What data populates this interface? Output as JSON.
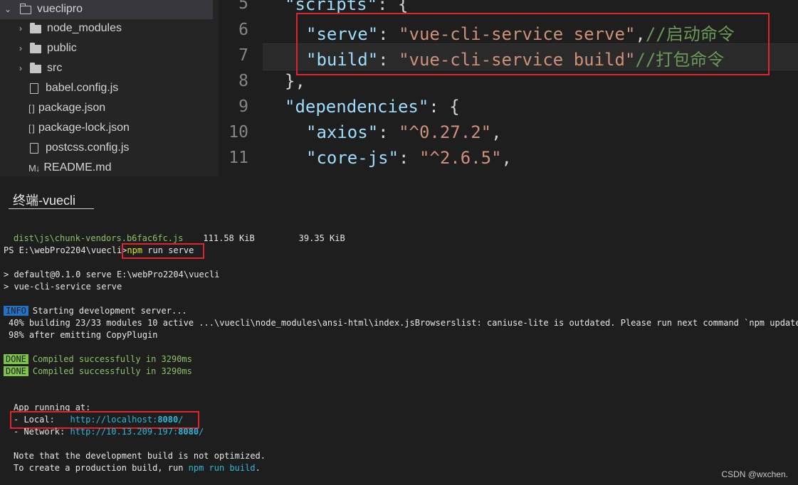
{
  "explorer": {
    "root": {
      "label": "vueclipro"
    },
    "items": [
      {
        "label": "node_modules"
      },
      {
        "label": "public"
      },
      {
        "label": "src"
      },
      {
        "label": "babel.config.js",
        "icon_glyph": ""
      },
      {
        "label": "package.json",
        "icon_glyph": "[ ]"
      },
      {
        "label": "package-lock.json",
        "icon_glyph": "[ ]"
      },
      {
        "label": "postcss.config.js",
        "icon_glyph": ""
      },
      {
        "label": "README.md",
        "icon_glyph": "M↓"
      }
    ]
  },
  "editor": {
    "lines": [
      {
        "num": "5",
        "t1": "\"scripts\"",
        "t2": ": {",
        "t3": "",
        "t4": "",
        "t5": ""
      },
      {
        "num": "6",
        "t1": "\"serve\"",
        "t2": ": ",
        "t3": "\"vue-cli-service serve\"",
        "t4": ",",
        "t5": "//启动命令"
      },
      {
        "num": "7",
        "t1": "\"build\"",
        "t2": ": ",
        "t3": "\"vue-cli-service build\"",
        "t4": "",
        "t5": "//打包命令"
      },
      {
        "num": "8",
        "t1": "",
        "t2": "},",
        "t3": "",
        "t4": "",
        "t5": ""
      },
      {
        "num": "9",
        "t1": "\"dependencies\"",
        "t2": ": {",
        "t3": "",
        "t4": "",
        "t5": ""
      },
      {
        "num": "10",
        "t1": "\"axios\"",
        "t2": ": ",
        "t3": "\"^0.27.2\"",
        "t4": ",",
        "t5": ""
      },
      {
        "num": "11",
        "t1": "\"core-js\"",
        "t2": ": ",
        "t3": "\"^2.6.5\"",
        "t4": ",",
        "t5": ""
      }
    ]
  },
  "terminal": {
    "tab_label": "终端-vuecli",
    "line_chunk_name": "dist\\js\\chunk-vendors.b6fac6fc.js",
    "line_chunk_size": "111.58 KiB",
    "line_chunk_gzip": "39.35 KiB",
    "prompt": "PS E:\\webPro2204\\vuecli>",
    "command_npm": "npm",
    "command_rest": " run serve",
    "line_default": "> default@0.1.0 serve E:\\webPro2204\\vuecli",
    "line_service": "> vue-cli-service serve",
    "info_badge": "INFO",
    "info_text": "Starting development server...",
    "line_building": "40% building 23/33 modules 10 active ...\\vuecli\\node_modules\\ansi-html\\index.jsBrowserslist: caniuse-lite is outdated. Please run next command `npm update`",
    "line_emitting": "98% after emitting CopyPlugin",
    "done_badge": "DONE",
    "done_text": "Compiled successfully in 3290ms",
    "app_running": "App running at:",
    "local_label": "- Local:   ",
    "local_url_base": "http://localhost:",
    "local_url_port": "8080",
    "local_url_tail": "/",
    "network_label": "- Network: ",
    "network_url_base": "http://10.13.209.197:",
    "network_url_port": "8080",
    "network_url_tail": "/",
    "note_line": "Note that the development build is not optimized.",
    "create_prefix": "To create a production build, run ",
    "create_cmd": "npm run build",
    "create_suffix": "."
  },
  "watermark": "CSDN @wxchen.",
  "colors": {
    "highlight_box": "#e0242b",
    "json_key": "#9cdcfe",
    "json_string": "#ce9178",
    "comment": "#6a9955"
  }
}
